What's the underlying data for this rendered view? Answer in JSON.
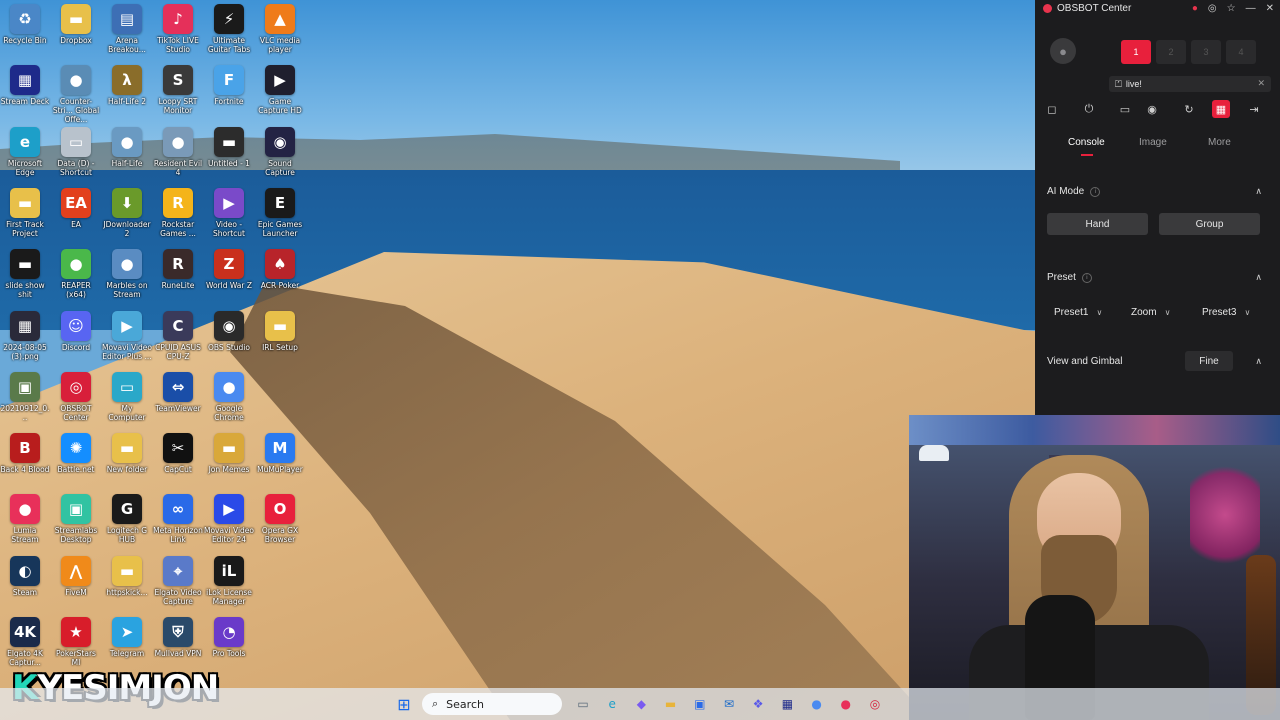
{
  "desktop": {
    "icons": [
      {
        "label": "Recycle Bin",
        "glyph": "♻",
        "color": "#4a87c7"
      },
      {
        "label": "Dropbox",
        "glyph": "▬",
        "color": "#e8c04a"
      },
      {
        "label": "Arena Breakou...",
        "glyph": "▤",
        "color": "#3d6fb5"
      },
      {
        "label": "TikTok LIVE Studio",
        "glyph": "♪",
        "color": "#e5305a"
      },
      {
        "label": "Ultimate Guitar Tabs",
        "glyph": "⚡",
        "color": "#1a1a1a"
      },
      {
        "label": "VLC media player",
        "glyph": "▲",
        "color": "#ef7b1a"
      },
      {
        "label": "Stream Deck",
        "glyph": "▦",
        "color": "#1e2a8a"
      },
      {
        "label": "Counter-Stri... Global Offe...",
        "glyph": "●",
        "color": "#5a8cb5"
      },
      {
        "label": "Half-Life 2",
        "glyph": "λ",
        "color": "#8a6d2a"
      },
      {
        "label": "Loopy SRT Monitor",
        "glyph": "S",
        "color": "#3a3a3a"
      },
      {
        "label": "Fortnite",
        "glyph": "F",
        "color": "#4aa3e8"
      },
      {
        "label": "Game Capture HD",
        "glyph": "▶",
        "color": "#1f1f2e"
      },
      {
        "label": "Microsoft Edge",
        "glyph": "e",
        "color": "#1d9fc9"
      },
      {
        "label": "Data (D) - Shortcut",
        "glyph": "▭",
        "color": "#b8c2cc"
      },
      {
        "label": "Half-Life",
        "glyph": "●",
        "color": "#6a9ac2"
      },
      {
        "label": "Resident Evil 4",
        "glyph": "●",
        "color": "#7a9ab8"
      },
      {
        "label": "Untitled - 1",
        "glyph": "▬",
        "color": "#2c2c2c"
      },
      {
        "label": "Sound Capture",
        "glyph": "◉",
        "color": "#232344"
      },
      {
        "label": "First Track Project",
        "glyph": "▬",
        "color": "#e8c04a"
      },
      {
        "label": "EA",
        "glyph": "EA",
        "color": "#e2401d"
      },
      {
        "label": "JDownloader 2",
        "glyph": "⬇",
        "color": "#6a9a2a"
      },
      {
        "label": "Rockstar Games ...",
        "glyph": "R",
        "color": "#f4b41a"
      },
      {
        "label": "Video - Shortcut",
        "glyph": "▶",
        "color": "#7a4ac9"
      },
      {
        "label": "Epic Games Launcher",
        "glyph": "E",
        "color": "#1a1a1a"
      },
      {
        "label": "slide show shit",
        "glyph": "▬",
        "color": "#1a1a1a"
      },
      {
        "label": "REAPER (x64)",
        "glyph": "●",
        "color": "#4ab84a"
      },
      {
        "label": "Marbles on Stream",
        "glyph": "●",
        "color": "#5a8cc2"
      },
      {
        "label": "RuneLite",
        "glyph": "R",
        "color": "#3a2a2a"
      },
      {
        "label": "World War Z",
        "glyph": "Z",
        "color": "#c9301d"
      },
      {
        "label": "ACR Poker",
        "glyph": "♠",
        "color": "#b8242a"
      },
      {
        "label": "2024-08-05 (3).png",
        "glyph": "▦",
        "color": "#2a2a3a"
      },
      {
        "label": "Discord",
        "glyph": "☺",
        "color": "#5865f2"
      },
      {
        "label": "Movavi Video Editor Plus ...",
        "glyph": "▶",
        "color": "#4aa8d8"
      },
      {
        "label": "CPUID ASUS CPU-Z",
        "glyph": "C",
        "color": "#3a3a5a"
      },
      {
        "label": "OBS Studio",
        "glyph": "◉",
        "color": "#2a2a2a"
      },
      {
        "label": "IRL Setup",
        "glyph": "▬",
        "color": "#e8c04a"
      },
      {
        "label": "20210912_0...",
        "glyph": "▣",
        "color": "#5a7a4a"
      },
      {
        "label": "OBSBOT Center",
        "glyph": "◎",
        "color": "#d81f3a"
      },
      {
        "label": "My Computer",
        "glyph": "▭",
        "color": "#2aa8c9"
      },
      {
        "label": "TeamViewer",
        "glyph": "⇔",
        "color": "#1a4ea8"
      },
      {
        "label": "Google Chrome",
        "glyph": "●",
        "color": "#4a8af0"
      },
      {
        "label": "",
        "glyph": "",
        "color": "transparent"
      },
      {
        "label": "Back 4 Blood",
        "glyph": "B",
        "color": "#b81d1d"
      },
      {
        "label": "Battle.net",
        "glyph": "✺",
        "color": "#148eff"
      },
      {
        "label": "New folder",
        "glyph": "▬",
        "color": "#e8c04a"
      },
      {
        "label": "CapCut",
        "glyph": "✂",
        "color": "#111111"
      },
      {
        "label": "Jon Memes",
        "glyph": "▬",
        "color": "#d9a83a"
      },
      {
        "label": "MuMuPlayer",
        "glyph": "M",
        "color": "#2a7af0"
      },
      {
        "label": "Lumia Stream",
        "glyph": "●",
        "color": "#e8305a"
      },
      {
        "label": "Streamlabs Desktop",
        "glyph": "▣",
        "color": "#31c3a2"
      },
      {
        "label": "Logitech G HUB",
        "glyph": "G",
        "color": "#1a1a1a"
      },
      {
        "label": "Meta Horizon Link",
        "glyph": "∞",
        "color": "#2a6ae8"
      },
      {
        "label": "Movavi Video Editor 24",
        "glyph": "▶",
        "color": "#2a4ae8"
      },
      {
        "label": "Opera GX Browser",
        "glyph": "O",
        "color": "#e8203c"
      },
      {
        "label": "Steam",
        "glyph": "◐",
        "color": "#17365a"
      },
      {
        "label": "FiveM",
        "glyph": "⋀",
        "color": "#f08a1a"
      },
      {
        "label": "httpskick...",
        "glyph": "▬",
        "color": "#e8c04a"
      },
      {
        "label": "Elgato Video Capture",
        "glyph": "⌖",
        "color": "#5a7ac9"
      },
      {
        "label": "iLok License Manager",
        "glyph": "iL",
        "color": "#1a1a1a"
      },
      {
        "label": "",
        "glyph": "",
        "color": "transparent"
      },
      {
        "label": "Elgato 4K Captur...",
        "glyph": "4K",
        "color": "#1a2a4a"
      },
      {
        "label": "PokerStars MI",
        "glyph": "★",
        "color": "#d81d2a"
      },
      {
        "label": "Telegram",
        "glyph": "➤",
        "color": "#2aa3e0"
      },
      {
        "label": "Mullvad VPN",
        "glyph": "⛨",
        "color": "#2a4a6a"
      },
      {
        "label": "Pro Tools",
        "glyph": "◔",
        "color": "#6a3ac9"
      },
      {
        "label": "",
        "glyph": "",
        "color": "transparent"
      }
    ]
  },
  "brand": {
    "k": "K",
    "rest": "YESIMJON"
  },
  "taskbar": {
    "start_icon": "⊞",
    "search_placeholder": "Search",
    "search_icon": "⌕",
    "pinned": [
      {
        "name": "task-view-icon",
        "glyph": "▭",
        "color": "#5a6a7a"
      },
      {
        "name": "edge-icon",
        "glyph": "e",
        "color": "#1d9fc9"
      },
      {
        "name": "copilot-icon",
        "glyph": "◆",
        "color": "#7a5af0"
      },
      {
        "name": "file-explorer-icon",
        "glyph": "▬",
        "color": "#e8b43a"
      },
      {
        "name": "store-icon",
        "glyph": "▣",
        "color": "#2a6ae8"
      },
      {
        "name": "mail-icon",
        "glyph": "✉",
        "color": "#1a6ac9"
      },
      {
        "name": "teams-icon",
        "glyph": "❖",
        "color": "#5a5ae8"
      },
      {
        "name": "stream-deck-icon",
        "glyph": "▦",
        "color": "#1e2a8a"
      },
      {
        "name": "chrome-icon",
        "glyph": "●",
        "color": "#4a8af0"
      },
      {
        "name": "lumia-icon",
        "glyph": "●",
        "color": "#e8305a"
      },
      {
        "name": "obsbot-icon",
        "glyph": "◎",
        "color": "#d81f3a"
      }
    ]
  },
  "obsbot": {
    "title": "OBSBOT Center",
    "window_controls": [
      "●",
      "◎",
      "☆",
      "—",
      "✕"
    ],
    "avatar_icon": "●",
    "slots": [
      "1",
      "2",
      "3",
      "4"
    ],
    "live_label": "live!",
    "live_icon": "⏍",
    "close": "✕",
    "tools": [
      "◻",
      "⏻",
      "▭",
      "◉",
      "↻",
      "▦",
      "⇥"
    ],
    "tabs": [
      "Console",
      "Image",
      "More"
    ],
    "ai_mode": {
      "title": "AI Mode",
      "buttons": [
        "Hand",
        "Group"
      ]
    },
    "preset": {
      "title": "Preset",
      "dropdowns": [
        "Preset1",
        "Zoom",
        "Preset3"
      ]
    },
    "view": {
      "title": "View and Gimbal",
      "mode_button": "Fine"
    },
    "chevron": "∧",
    "caret": "∨"
  }
}
